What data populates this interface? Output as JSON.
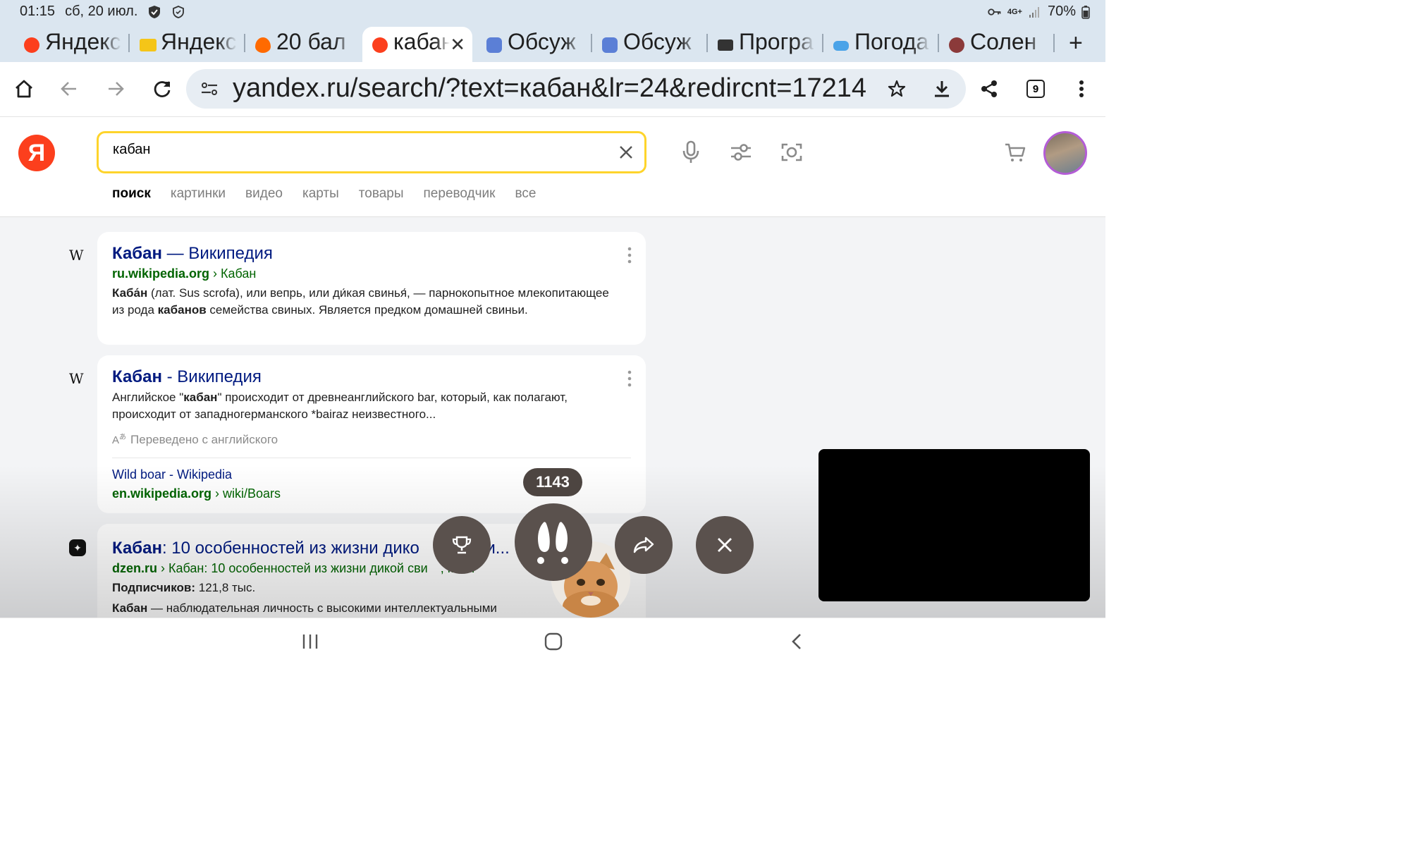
{
  "status_bar": {
    "time": "01:15",
    "date": "сб, 20 июл.",
    "network": "4G+",
    "battery": "70%"
  },
  "tabs": [
    {
      "label": "Яндекс",
      "favicon_color": "#fc3f1d",
      "active": false
    },
    {
      "label": "Яндекс",
      "favicon_color": "#f5c518",
      "active": false
    },
    {
      "label": "20 бал",
      "favicon_color": "#ff6a00",
      "active": false
    },
    {
      "label": "кабан",
      "favicon_color": "#fc3f1d",
      "active": true
    },
    {
      "label": "Обсуж",
      "favicon_color": "#5b7fd6",
      "active": false
    },
    {
      "label": "Обсуж",
      "favicon_color": "#5b7fd6",
      "active": false
    },
    {
      "label": "Програ",
      "favicon_color": "#333333",
      "active": false
    },
    {
      "label": "Погода",
      "favicon_color": "#4aa3e8",
      "active": false
    },
    {
      "label": "Солен",
      "favicon_color": "#8b3a3a",
      "active": false
    }
  ],
  "toolbar": {
    "url": "yandex.ru/search/?text=кабан&lr=24&redircnt=17214",
    "tab_count": "9"
  },
  "yandex": {
    "logo_letter": "Я",
    "query": "кабан",
    "nav": [
      "поиск",
      "картинки",
      "видео",
      "карты",
      "товары",
      "переводчик",
      "все"
    ]
  },
  "results": [
    {
      "favicon": "W",
      "title_bold": "Кабан",
      "title_rest": " — Википедия",
      "domain": "ru.wikipedia.org",
      "breadcrumb": " › Кабан",
      "snippet_html": "<b>Каба́н</b> (лат. Sus scrofa), или вепрь, или ди́кая свинья́, — парнокопытное млекопитающее из рода <b>кабанов</b> семейства свиных. Является предком домашней свиньи."
    },
    {
      "favicon": "W",
      "title_bold": "Кабан",
      "title_rest": " - Википедия",
      "snippet_html": "Английское \"<b>кабан</b>\" происходит от древнеанглийского bar, который, как полагают, происходит от западногерманского *bairaz неизвестного...",
      "translated": "Переведено с английского",
      "sub_title": "Wild boar - Wikipedia",
      "sub_domain": "en.wikipedia.org",
      "sub_breadcrumb": " › wiki/Boars"
    },
    {
      "favicon": "✦",
      "title_bold": "Кабан",
      "title_rest": ": 10 особенностей из жизни дико",
      "title_tail": "ьи...",
      "domain": "dzen.ru",
      "breadcrumb": " › Кабан: 10 особенностей из жизни дикой сви",
      "breadcrumb_tail": ", кот...",
      "subscribers_label": "Подписчиков:",
      "subscribers_value": " 121,8 тыс.",
      "snippet_bold": "Кабан",
      "snippet_rest": " — наблюдательная личность с высокими интеллектуальными"
    }
  ],
  "overlay": {
    "counter": "1143"
  }
}
